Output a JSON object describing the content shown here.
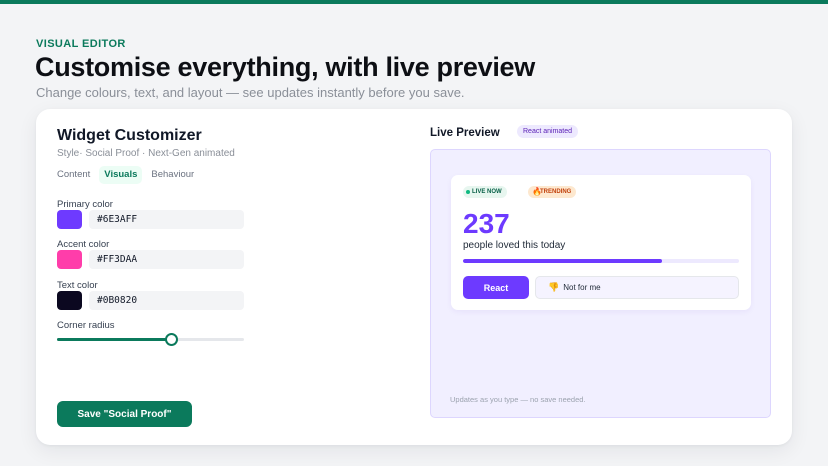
{
  "hero": {
    "eyebrow": "VISUAL EDITOR",
    "title": "Customise everything, with live preview",
    "subtitle": "Change colours, text, and layout — see updates instantly before you save."
  },
  "editor": {
    "title": "Widget Customizer",
    "subtitle": "Style· Social Proof · Next-Gen animated",
    "tabs": [
      {
        "label": "Content",
        "active": false
      },
      {
        "label": "Visuals",
        "active": true
      },
      {
        "label": "Behaviour",
        "active": false
      }
    ],
    "fields": {
      "primary": {
        "label": "Primary color",
        "value": "#6E3AFF",
        "color": "#6E3AFF"
      },
      "accent": {
        "label": "Accent color",
        "value": "#FF3DAA",
        "color": "#FF3DAA"
      },
      "text": {
        "label": "Text color",
        "value": "#0B0820",
        "color": "#0B0820"
      }
    },
    "corner_radius": {
      "label": "Corner radius",
      "level": 0.61
    },
    "save_label": "Save \"Social Proof\""
  },
  "preview": {
    "label": "Live Preview",
    "badge": "React animated",
    "widget": {
      "live_pill": "LIVE NOW",
      "trend_pill": "TRENDING",
      "trend_icon": "fire-icon",
      "count": "237",
      "caption": "people loved this today",
      "progress": 0.72,
      "react_label": "React",
      "not_for_me_label": "Not for me",
      "not_for_me_icon": "thumbs-down-icon"
    },
    "footnote": "Updates as you type — no save needed."
  },
  "colors": {
    "brand_green": "#0B7A5C",
    "widget_purple": "#6D3AFF"
  }
}
